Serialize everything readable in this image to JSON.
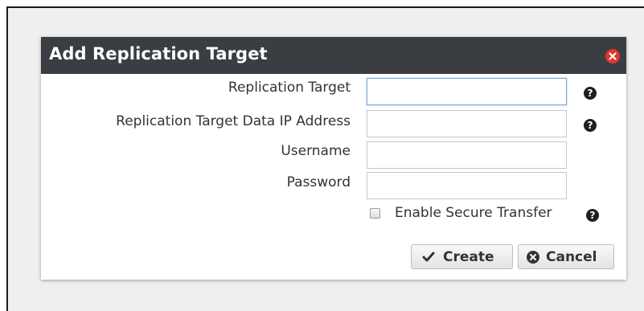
{
  "dialog": {
    "title": "Add Replication Target",
    "close_icon": "close-circle-icon",
    "close_color": "#e0342d",
    "titlebar_color": "#3a3e43"
  },
  "form": {
    "replication_target": {
      "label": "Replication Target",
      "value": "",
      "help_glyph": "?"
    },
    "data_ip_address": {
      "label": "Replication Target Data IP Address",
      "value": "",
      "help_glyph": "?"
    },
    "username": {
      "label": "Username",
      "value": ""
    },
    "password": {
      "label": "Password",
      "value": ""
    },
    "secure_transfer": {
      "label": "Enable Secure Transfer",
      "checked": false,
      "help_glyph": "?"
    }
  },
  "actions": {
    "create_label": "Create",
    "create_icon": "checkmark-icon",
    "cancel_label": "Cancel",
    "cancel_icon": "cancel-circle-icon"
  }
}
